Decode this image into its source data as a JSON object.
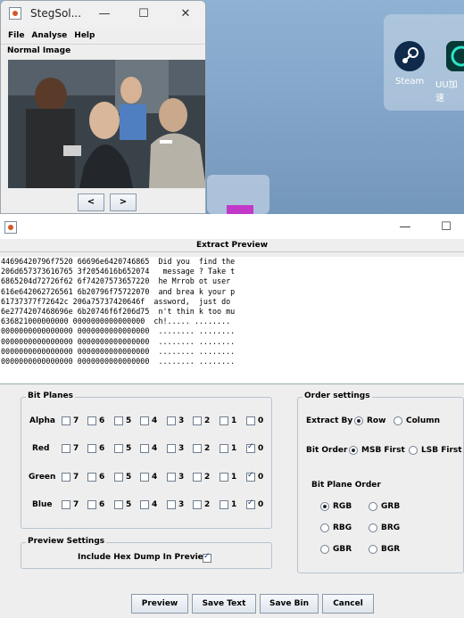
{
  "desktop": {
    "icons": [
      {
        "name": "steam-icon",
        "label": "Steam",
        "color": "#0f2a4a"
      },
      {
        "name": "uu-icon",
        "label": "UU加速",
        "color": "#073a37"
      }
    ]
  },
  "viewer": {
    "title": "StegSol...",
    "controls": {
      "minimize": "—",
      "maximize": "☐",
      "close": "✕"
    },
    "menu": [
      "File",
      "Analyse",
      "Help"
    ],
    "label": "Normal Image",
    "prev": "<",
    "next": ">"
  },
  "extract": {
    "controls": {
      "minimize": "—",
      "maximize": "☐"
    },
    "header": "Extract Preview",
    "rows": [
      "44696420796f7520 66696e6420746865  Did you  find the",
      "206d657373616765 3f2054616b652074   message ? Take t",
      "6865204d72726f62 6f74207573657220  he Mrrob ot user",
      "616e642062726561 6b20796f75722070  and brea k your p",
      "61737377f72642c 206a75737420646f  assword,  just do",
      "6e2774207468696e 6b20746f6f206d75  n't thin k too mu",
      "636821000000000 0000000000000000  ch!..... ........",
      "0000000000000000 0000000000000000  ........ ........",
      "0000000000000000 0000000000000000  ........ ........",
      "0000000000000000 0000000000000000  ........ ........",
      "0000000000000000 0000000000000000  ........ ........"
    ],
    "bit_planes": {
      "title": "Bit Planes",
      "bits": [
        "7",
        "6",
        "5",
        "4",
        "3",
        "2",
        "1",
        "0"
      ],
      "rows": [
        {
          "label": "Alpha",
          "checked": []
        },
        {
          "label": "Red",
          "checked": [
            "0"
          ]
        },
        {
          "label": "Green",
          "checked": [
            "0"
          ]
        },
        {
          "label": "Blue",
          "checked": [
            "0"
          ]
        }
      ]
    },
    "preview_settings": {
      "title": "Preview Settings",
      "hex_label": "Include Hex Dump In Preview",
      "hex_checked": true
    },
    "order_settings": {
      "title": "Order settings",
      "extract_by_label": "Extract By",
      "extract_by": [
        "Row",
        "Column"
      ],
      "extract_by_selected": "Row",
      "bit_order_label": "Bit Order",
      "bit_order": [
        "MSB First",
        "LSB First"
      ],
      "bit_order_selected": "MSB First",
      "plane_order_label": "Bit Plane Order",
      "plane_order": [
        "RGB",
        "GRB",
        "RBG",
        "BRG",
        "GBR",
        "BGR"
      ],
      "plane_order_selected": "RGB"
    },
    "buttons": [
      "Preview",
      "Save Text",
      "Save Bin",
      "Cancel"
    ]
  }
}
